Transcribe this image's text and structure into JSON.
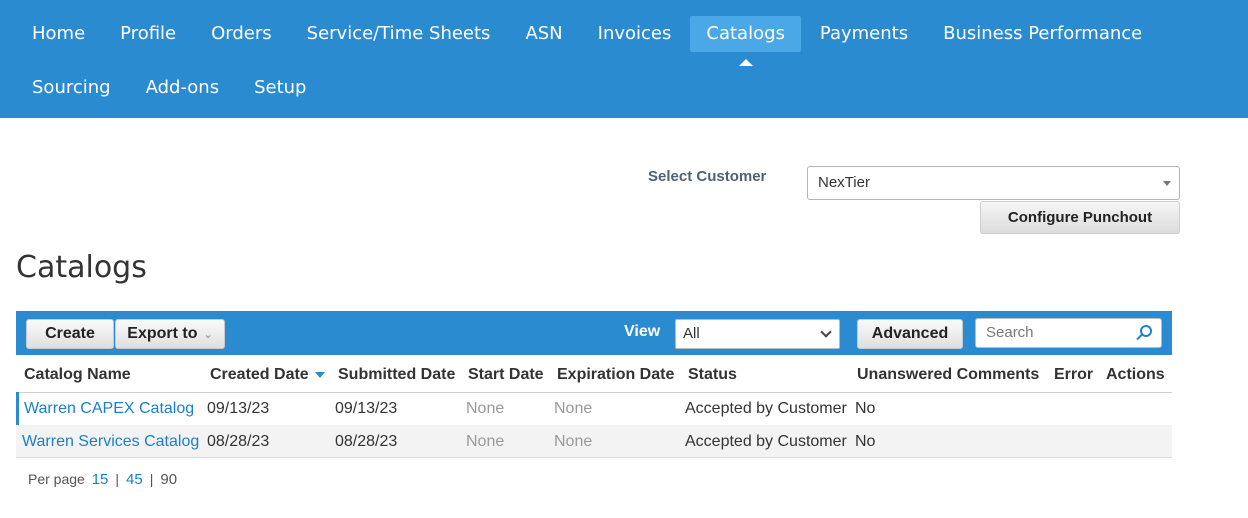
{
  "nav": {
    "row1": [
      "Home",
      "Profile",
      "Orders",
      "Service/Time Sheets",
      "ASN",
      "Invoices",
      "Catalogs",
      "Payments",
      "Business Performance"
    ],
    "row2": [
      "Sourcing",
      "Add-ons",
      "Setup"
    ],
    "active": "Catalogs"
  },
  "customer": {
    "label": "Select Customer",
    "value": "NexTier",
    "punchout_label": "Configure Punchout"
  },
  "page_title": "Catalogs",
  "toolbar": {
    "create_label": "Create",
    "export_label": "Export to",
    "view_label": "View",
    "view_value": "All",
    "advanced_label": "Advanced",
    "search_placeholder": "Search"
  },
  "table": {
    "columns": [
      "Catalog Name",
      "Created Date",
      "Submitted Date",
      "Start Date",
      "Expiration Date",
      "Status",
      "Unanswered Comments",
      "Error",
      "Actions"
    ],
    "rows": [
      {
        "name": "Warren CAPEX Catalog",
        "created": "09/13/23",
        "submitted": "09/13/23",
        "start": "None",
        "expiration": "None",
        "status": "Accepted by Customer",
        "comments": "No"
      },
      {
        "name": "Warren Services Catalog",
        "created": "08/28/23",
        "submitted": "08/28/23",
        "start": "None",
        "expiration": "None",
        "status": "Accepted by Customer",
        "comments": "No"
      }
    ]
  },
  "pagination": {
    "label": "Per page",
    "options": [
      "15",
      "45",
      "90"
    ]
  },
  "colors": {
    "brand_blue": "#2b8bd1",
    "active_tab": "#4aa8e6",
    "link": "#1b7fcc"
  }
}
